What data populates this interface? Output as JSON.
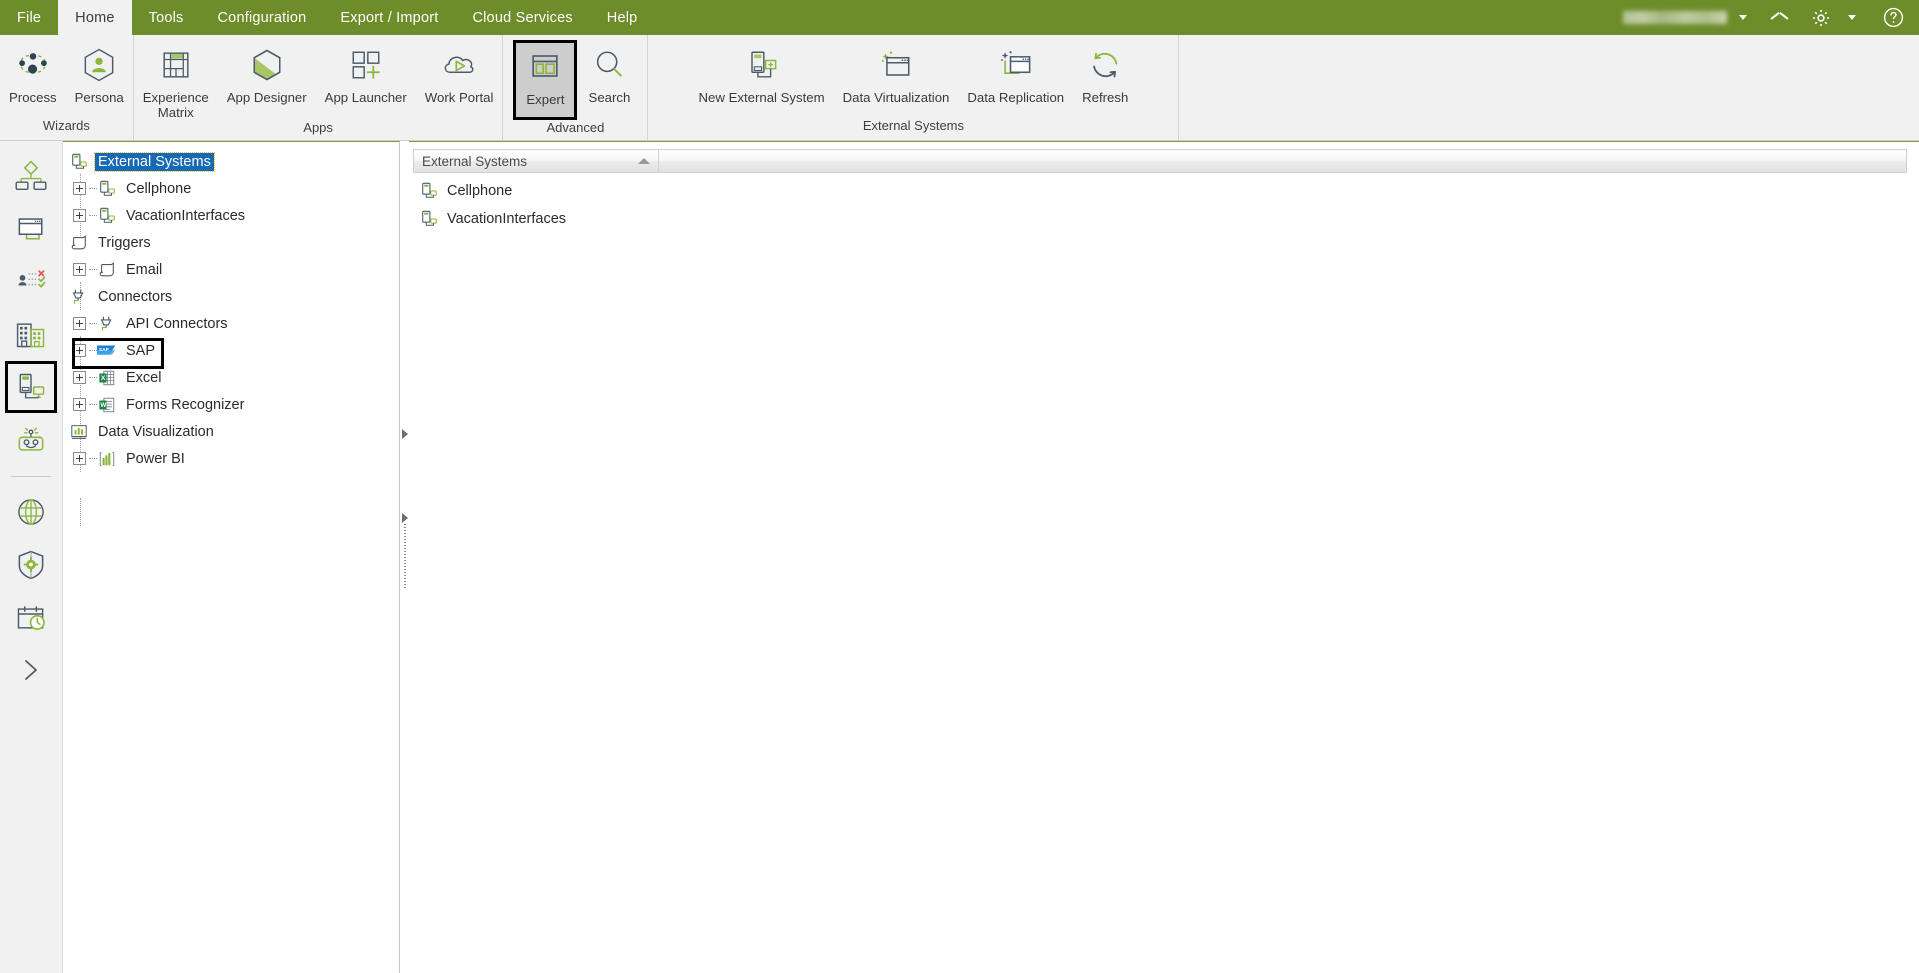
{
  "menu": {
    "items": [
      {
        "label": "File",
        "active": false
      },
      {
        "label": "Home",
        "active": true
      },
      {
        "label": "Tools",
        "active": false
      },
      {
        "label": "Configuration",
        "active": false
      },
      {
        "label": "Export / Import",
        "active": false
      },
      {
        "label": "Cloud Services",
        "active": false
      },
      {
        "label": "Help",
        "active": false
      }
    ],
    "user_name": "",
    "icons": {
      "user_caret": "caret-down-icon",
      "collapse": "chevron-up-icon",
      "settings": "gear-icon",
      "settings_caret": "caret-down-icon",
      "help": "help-circle-icon"
    }
  },
  "ribbon": {
    "groups": [
      {
        "label": "Wizards",
        "buttons": [
          {
            "label": "Process",
            "icon": "process-icon",
            "selected": false
          },
          {
            "label": "Persona",
            "icon": "persona-icon",
            "selected": false
          }
        ]
      },
      {
        "label": "Apps",
        "buttons": [
          {
            "label": "Experience\nMatrix",
            "icon": "experience-matrix-icon",
            "selected": false
          },
          {
            "label": "App Designer",
            "icon": "app-designer-icon",
            "selected": false
          },
          {
            "label": "App Launcher",
            "icon": "app-launcher-icon",
            "selected": false
          },
          {
            "label": "Work Portal",
            "icon": "work-portal-icon",
            "selected": false
          }
        ]
      },
      {
        "label": "Advanced",
        "buttons": [
          {
            "label": "Expert",
            "icon": "expert-icon",
            "selected": true
          },
          {
            "label": "Search",
            "icon": "search-icon",
            "selected": false
          }
        ]
      },
      {
        "label": "External Systems",
        "buttons": [
          {
            "label": "New External System",
            "icon": "new-external-system-icon",
            "selected": false
          },
          {
            "label": "Data Virtualization",
            "icon": "data-virtualization-icon",
            "selected": false
          },
          {
            "label": "Data Replication",
            "icon": "data-replication-icon",
            "selected": false
          },
          {
            "label": "Refresh",
            "icon": "refresh-icon",
            "selected": false
          }
        ]
      }
    ]
  },
  "rail": {
    "items": [
      {
        "name": "process-rail-icon",
        "selected": false
      },
      {
        "name": "forms-rail-icon",
        "selected": false
      },
      {
        "name": "rules-rail-icon",
        "selected": false
      },
      {
        "name": "organization-rail-icon",
        "selected": false
      },
      {
        "name": "integration-rail-icon",
        "selected": true
      },
      {
        "name": "bot-rail-icon",
        "selected": false
      },
      {
        "name": "globe-rail-icon",
        "selected": false
      },
      {
        "name": "security-rail-icon",
        "selected": false
      },
      {
        "name": "calendar-rail-icon",
        "selected": false
      }
    ],
    "expand": "chevron-right-icon"
  },
  "tree": {
    "nodes": [
      {
        "label": "External Systems",
        "icon": "external-system-icon",
        "level": 0,
        "expander": false,
        "selected": true,
        "focus": false
      },
      {
        "label": "Cellphone",
        "icon": "external-system-icon",
        "level": 1,
        "expander": true,
        "selected": false,
        "focus": false
      },
      {
        "label": "VacationInterfaces",
        "icon": "external-system-icon",
        "level": 1,
        "expander": true,
        "selected": false,
        "focus": false
      },
      {
        "label": "Triggers",
        "icon": "trigger-icon",
        "level": 0,
        "expander": false,
        "selected": false,
        "focus": false
      },
      {
        "label": "Email",
        "icon": "trigger-icon",
        "level": 1,
        "expander": true,
        "selected": false,
        "focus": false
      },
      {
        "label": "Connectors",
        "icon": "connector-icon",
        "level": 0,
        "expander": false,
        "selected": false,
        "focus": false
      },
      {
        "label": "API Connectors",
        "icon": "connector-icon",
        "level": 1,
        "expander": true,
        "selected": false,
        "focus": false
      },
      {
        "label": "SAP",
        "icon": "sap-icon",
        "level": 1,
        "expander": true,
        "selected": false,
        "focus": true
      },
      {
        "label": "Excel",
        "icon": "excel-icon",
        "level": 1,
        "expander": true,
        "selected": false,
        "focus": false
      },
      {
        "label": "Forms Recognizer",
        "icon": "forms-recognizer-icon",
        "level": 1,
        "expander": true,
        "selected": false,
        "focus": false
      },
      {
        "label": "Data Visualization",
        "icon": "data-visualization-icon",
        "level": 0,
        "expander": false,
        "selected": false,
        "focus": false
      },
      {
        "label": "Power BI",
        "icon": "power-bi-icon",
        "level": 1,
        "expander": true,
        "selected": false,
        "focus": false
      }
    ]
  },
  "list": {
    "column_header": "External Systems",
    "sort": "ascending",
    "rows": [
      {
        "label": "Cellphone",
        "icon": "external-system-icon"
      },
      {
        "label": "VacationInterfaces",
        "icon": "external-system-icon"
      }
    ]
  },
  "colors": {
    "brand_green": "#6d8c2a",
    "accent_green": "#8cb63c",
    "selection_blue": "#1669b5",
    "ribbon_bg": "#f1f1f1"
  }
}
